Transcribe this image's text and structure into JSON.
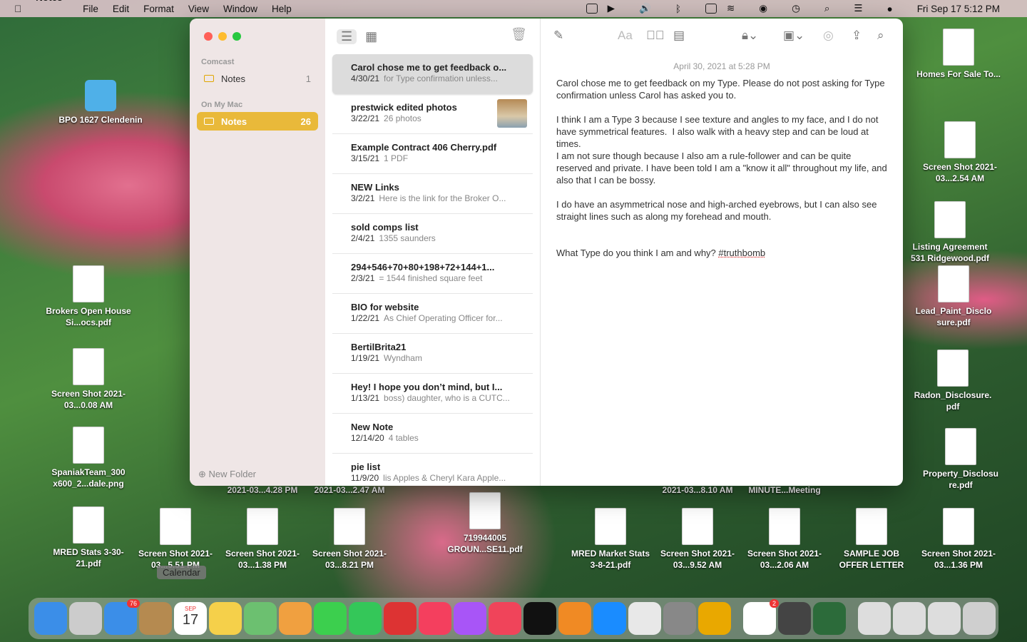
{
  "menubar": {
    "app": "Notes",
    "items": [
      "File",
      "Edit",
      "Format",
      "View",
      "Window",
      "Help"
    ],
    "clock": "Fri Sep 17  5:12 PM"
  },
  "sidebar": {
    "sections": [
      {
        "label": "Comcast",
        "folder": "Notes",
        "count": "1"
      },
      {
        "label": "On My Mac",
        "folder": "Notes",
        "count": "26"
      }
    ],
    "new_folder": "New Folder"
  },
  "notes": [
    {
      "title": "Carol chose me to get feedback o...",
      "date": "4/30/21",
      "snippet": "for Type confirmation unless..."
    },
    {
      "title": "prestwick edited photos",
      "date": "3/22/21",
      "snippet": "26 photos"
    },
    {
      "title": "Example Contract 406 Cherry.pdf",
      "date": "3/15/21",
      "snippet": "1 PDF"
    },
    {
      "title": "NEW Links",
      "date": "3/2/21",
      "snippet": "Here is the link for the Broker O..."
    },
    {
      "title": "sold comps list",
      "date": "2/4/21",
      "snippet": "1355 saunders"
    },
    {
      "title": "294+546+70+80+198+72+144+1...",
      "date": "2/3/21",
      "snippet": "= 1544 finished square feet"
    },
    {
      "title": "BIO for website",
      "date": "1/22/21",
      "snippet": "As Chief Operating Officer for..."
    },
    {
      "title": "BertilBrita21",
      "date": "1/19/21",
      "snippet": "Wyndham"
    },
    {
      "title": "Hey! I hope you don’t mind, but I...",
      "date": "1/13/21",
      "snippet": "boss) daughter, who is a CUTC..."
    },
    {
      "title": "New Note",
      "date": "12/14/20",
      "snippet": "4 tables"
    },
    {
      "title": "pie list",
      "date": "11/9/20",
      "snippet": "lis Apples & Cheryl Kara Apple..."
    }
  ],
  "editor": {
    "date": "April 30, 2021 at 5:28 PM",
    "body": "Carol chose me to get feedback on my Type. Please do not post asking for Type confirmation unless Carol has asked you to.\n\nI think I am a Type 3 because I see texture and angles to my face, and I do not have symmetrical features.  I also walk with a heavy step and can be loud at times.\nI am not sure though because I also am a rule-follower and can be quite reserved and private. I have been told I am a \"know it all\" throughout my life, and also that I can be bossy.\n\nI do have an asymmetrical nose and high-arched eyebrows, but I can also see straight lines such as along my forehead and mouth.\n\n\nWhat Type do you think I am and why? ",
    "hashtag": "#truthbomb"
  },
  "desktop": [
    {
      "label": "BPO 1627 Clendenin"
    },
    {
      "label": "Brokers Open House Si...ocs.pdf"
    },
    {
      "label": "Screen Shot 2021-03...0.08 AM"
    },
    {
      "label": "SpaniakTeam_300 x600_2...dale.png"
    },
    {
      "label": "MRED Stats 3-30-21.pdf"
    },
    {
      "label": "Screen Shot 2021-03...5.51 PM"
    },
    {
      "label": "Screen Shot 2021-03...1.38 PM"
    },
    {
      "label": "Screen Shot 2021-03...8.21 PM"
    },
    {
      "label": "719944005 GROUN...SE11.pdf"
    },
    {
      "label": "MRED Market Stats 3-8-21.pdf"
    },
    {
      "label": "Screen Shot 2021-03...9.52 AM"
    },
    {
      "label": "Screen Shot 2021-03...2.06 AM"
    },
    {
      "label": "SAMPLE JOB OFFER LETTER"
    },
    {
      "label": "Screen Shot 2021-03...1.36 PM"
    },
    {
      "label": "Homes For Sale To..."
    },
    {
      "label": "Screen Shot 2021-03...2.54 AM"
    },
    {
      "label": "Listing Agreement 531 Ridgewood.pdf"
    },
    {
      "label": "Lead_Paint_Disclo sure.pdf"
    },
    {
      "label": "Radon_Disclosure. pdf"
    },
    {
      "label": "Property_Disclosu re.pdf"
    },
    {
      "label": "2021-03...4.28 PM"
    },
    {
      "label": "2021-03...2.47 AM"
    },
    {
      "label": "2021-03...8.10 AM"
    },
    {
      "label": "MINUTE...Meeting"
    }
  ],
  "dock": {
    "tooltip": "Calendar",
    "mail_badge": "76",
    "calendar_month": "SEP",
    "calendar_day": "17",
    "r_badge": "2",
    "apps": [
      "finder",
      "launchpad",
      "mail",
      "contacts",
      "calendar",
      "notes",
      "maps",
      "photos",
      "messages",
      "facetime",
      "photo-booth",
      "music",
      "podcasts",
      "news",
      "tv",
      "books",
      "app-store",
      "chrome",
      "system-preferences",
      "stack",
      "realtor",
      "calculator",
      "activity",
      "window1",
      "window2",
      "window3",
      "trash"
    ],
    "colors": [
      "#3b8ee8",
      "#ccc",
      "#3b8ee8",
      "#b58a50",
      "#fff",
      "#f5d04a",
      "#6cc070",
      "#f0a040",
      "#3ccf4e",
      "#34c759",
      "#d33",
      "#f43f5e",
      "#a855f7",
      "#f0445a",
      "#111",
      "#f08a24",
      "#1a8cff",
      "#e8e8e8",
      "#888",
      "#e9a800",
      "#fff",
      "#444",
      "#2c6b3a",
      "#ddd",
      "#ddd",
      "#ddd",
      "#cfcfcf"
    ]
  }
}
